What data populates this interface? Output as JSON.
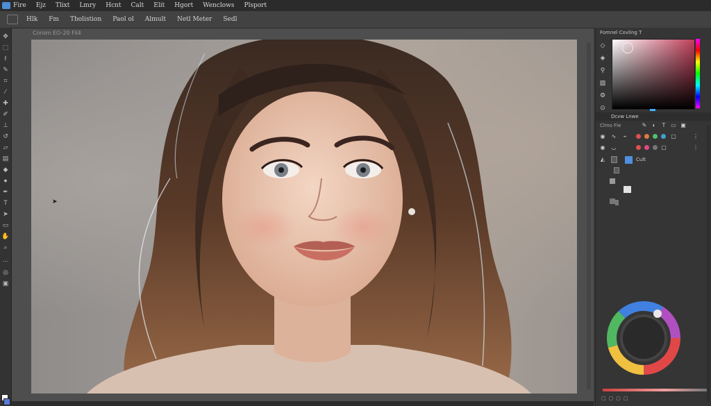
{
  "menu": {
    "items": [
      "Fire",
      "Ejz",
      "Tlixt",
      "Lmry",
      "Hcnt",
      "Calt",
      "Elit",
      "Hgort",
      "Wenclows",
      "Plsport"
    ]
  },
  "options_bar": {
    "items": [
      "Hlk",
      "Fm",
      "Tholistion",
      "Paol ol",
      "Almult",
      "Netl Meter",
      "Sedl"
    ]
  },
  "document": {
    "tab_label": "Cnrom  EO-20  Fil4"
  },
  "color_panel": {
    "tabs": "Fomnel  Covling  T"
  },
  "layers_panel": {
    "tab_label": "Dcvw Lnwe",
    "filter_label": "Clmo Fle",
    "layer_name": "Cult"
  },
  "colors": {
    "accent": "#4e8fe0",
    "background_swatch": "#5a7ad8",
    "foreground_swatch": "#ffffff",
    "hair": "#5a3a28",
    "skin": "#e8c2ab",
    "lips": "#c96f62"
  },
  "icons": {
    "tools": [
      "move-icon",
      "marquee-icon",
      "lasso-icon",
      "quick-select-icon",
      "crop-icon",
      "eyedropper-icon",
      "healing-icon",
      "brush-icon",
      "clone-stamp-icon",
      "history-brush-icon",
      "eraser-icon",
      "gradient-icon",
      "blur-icon",
      "dodge-icon",
      "pen-icon",
      "type-icon",
      "path-select-icon",
      "shape-icon",
      "hand-icon",
      "zoom-icon",
      "edit-toolbar-icon",
      "quick-mask-icon",
      "screen-mode-icon"
    ],
    "panel_strip": [
      "history-icon",
      "adjustments-icon",
      "paths-icon",
      "properties-icon",
      "brush-settings-icon",
      "channels-icon"
    ]
  }
}
